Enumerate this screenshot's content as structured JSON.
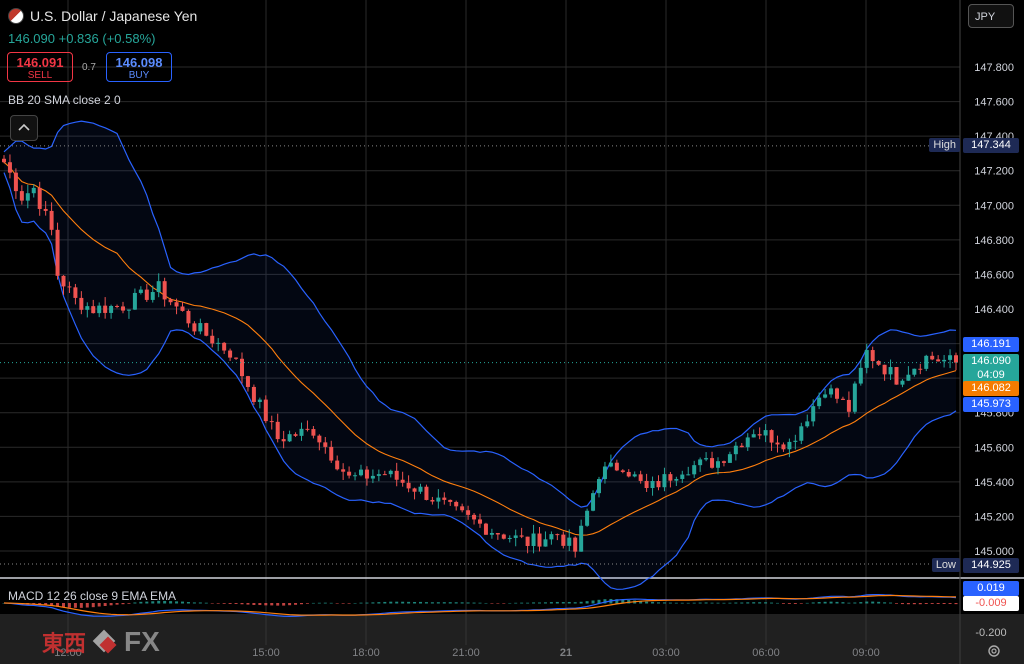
{
  "header": {
    "title": "U.S. Dollar / Japanese Yen",
    "last": "146.090",
    "change": "+0.836",
    "change_pct": "(+0.58%)",
    "sell_price": "146.091",
    "sell_label": "SELL",
    "spread": "0.7",
    "buy_price": "146.098",
    "buy_label": "BUY",
    "indicator": "BB 20 SMA close 2 0",
    "currency": "JPY"
  },
  "macd": {
    "label": "MACD 12 26 close 9 EMA EMA",
    "macd_value": "0.019",
    "signal_value": "-0.009",
    "axis_tick": "-0.200"
  },
  "price_tags": {
    "high_label": "High",
    "high_value": "147.344",
    "low_label": "Low",
    "low_value": "144.925",
    "bb_upper": "146.191",
    "last": "146.090",
    "countdown": "04:09",
    "bb_basis": "146.082",
    "bb_lower": "145.973"
  },
  "logo": {
    "text_jp": "東西",
    "text_fx": "FX"
  },
  "colors": {
    "up": "#26a69a",
    "down": "#ef5350",
    "bb_band": "#2962ff",
    "basis": "#ff7f0e",
    "grid": "#2a2a2a",
    "accent": "#2962ff"
  },
  "chart_data": {
    "type": "candlestick",
    "symbol": "U.S. Dollar / Japanese Yen",
    "yaxis": {
      "ticks": [
        145.0,
        145.2,
        145.4,
        145.6,
        145.8,
        146.0,
        146.2,
        146.4,
        146.6,
        146.8,
        147.0,
        147.2,
        147.4,
        147.6,
        147.8
      ],
      "ylim": [
        144.9,
        147.9
      ]
    },
    "xaxis": {
      "ticks": [
        "12:00",
        "15:00",
        "18:00",
        "21:00",
        "21",
        "03:00",
        "06:00",
        "09:00"
      ]
    },
    "close_path": [
      {
        "t": 0,
        "close": 147.25
      },
      {
        "t": 3,
        "close": 147.05
      },
      {
        "t": 5,
        "close": 147.1
      },
      {
        "t": 8,
        "close": 146.85
      },
      {
        "t": 9,
        "close": 146.6
      },
      {
        "t": 12,
        "close": 146.45
      },
      {
        "t": 15,
        "close": 146.4
      },
      {
        "t": 20,
        "close": 146.42
      },
      {
        "t": 26,
        "close": 146.52
      },
      {
        "t": 32,
        "close": 146.3
      },
      {
        "t": 38,
        "close": 146.15
      },
      {
        "t": 42,
        "close": 145.9
      },
      {
        "t": 46,
        "close": 145.65
      },
      {
        "t": 52,
        "close": 145.7
      },
      {
        "t": 58,
        "close": 145.42
      },
      {
        "t": 64,
        "close": 145.45
      },
      {
        "t": 70,
        "close": 145.35
      },
      {
        "t": 76,
        "close": 145.22
      },
      {
        "t": 82,
        "close": 145.12
      },
      {
        "t": 88,
        "close": 145.05
      },
      {
        "t": 93,
        "close": 145.1
      },
      {
        "t": 96,
        "close": 145.0
      },
      {
        "t": 100,
        "close": 145.45
      },
      {
        "t": 104,
        "close": 145.5
      },
      {
        "t": 108,
        "close": 145.35
      },
      {
        "t": 114,
        "close": 145.48
      },
      {
        "t": 120,
        "close": 145.52
      },
      {
        "t": 126,
        "close": 145.7
      },
      {
        "t": 132,
        "close": 145.62
      },
      {
        "t": 138,
        "close": 145.95
      },
      {
        "t": 142,
        "close": 145.82
      },
      {
        "t": 145,
        "close": 146.15
      },
      {
        "t": 150,
        "close": 146.0
      },
      {
        "t": 155,
        "close": 146.12
      },
      {
        "t": 160,
        "close": 146.09
      }
    ],
    "high": 147.344,
    "low": 144.925,
    "last": 146.09,
    "bollinger": {
      "period": 20,
      "stddev": 2,
      "upper": 146.191,
      "basis": 146.082,
      "lower": 145.973
    },
    "macd": {
      "fast": 12,
      "slow": 26,
      "signal": 9,
      "macd": 0.019,
      "signal_value": -0.009
    }
  }
}
